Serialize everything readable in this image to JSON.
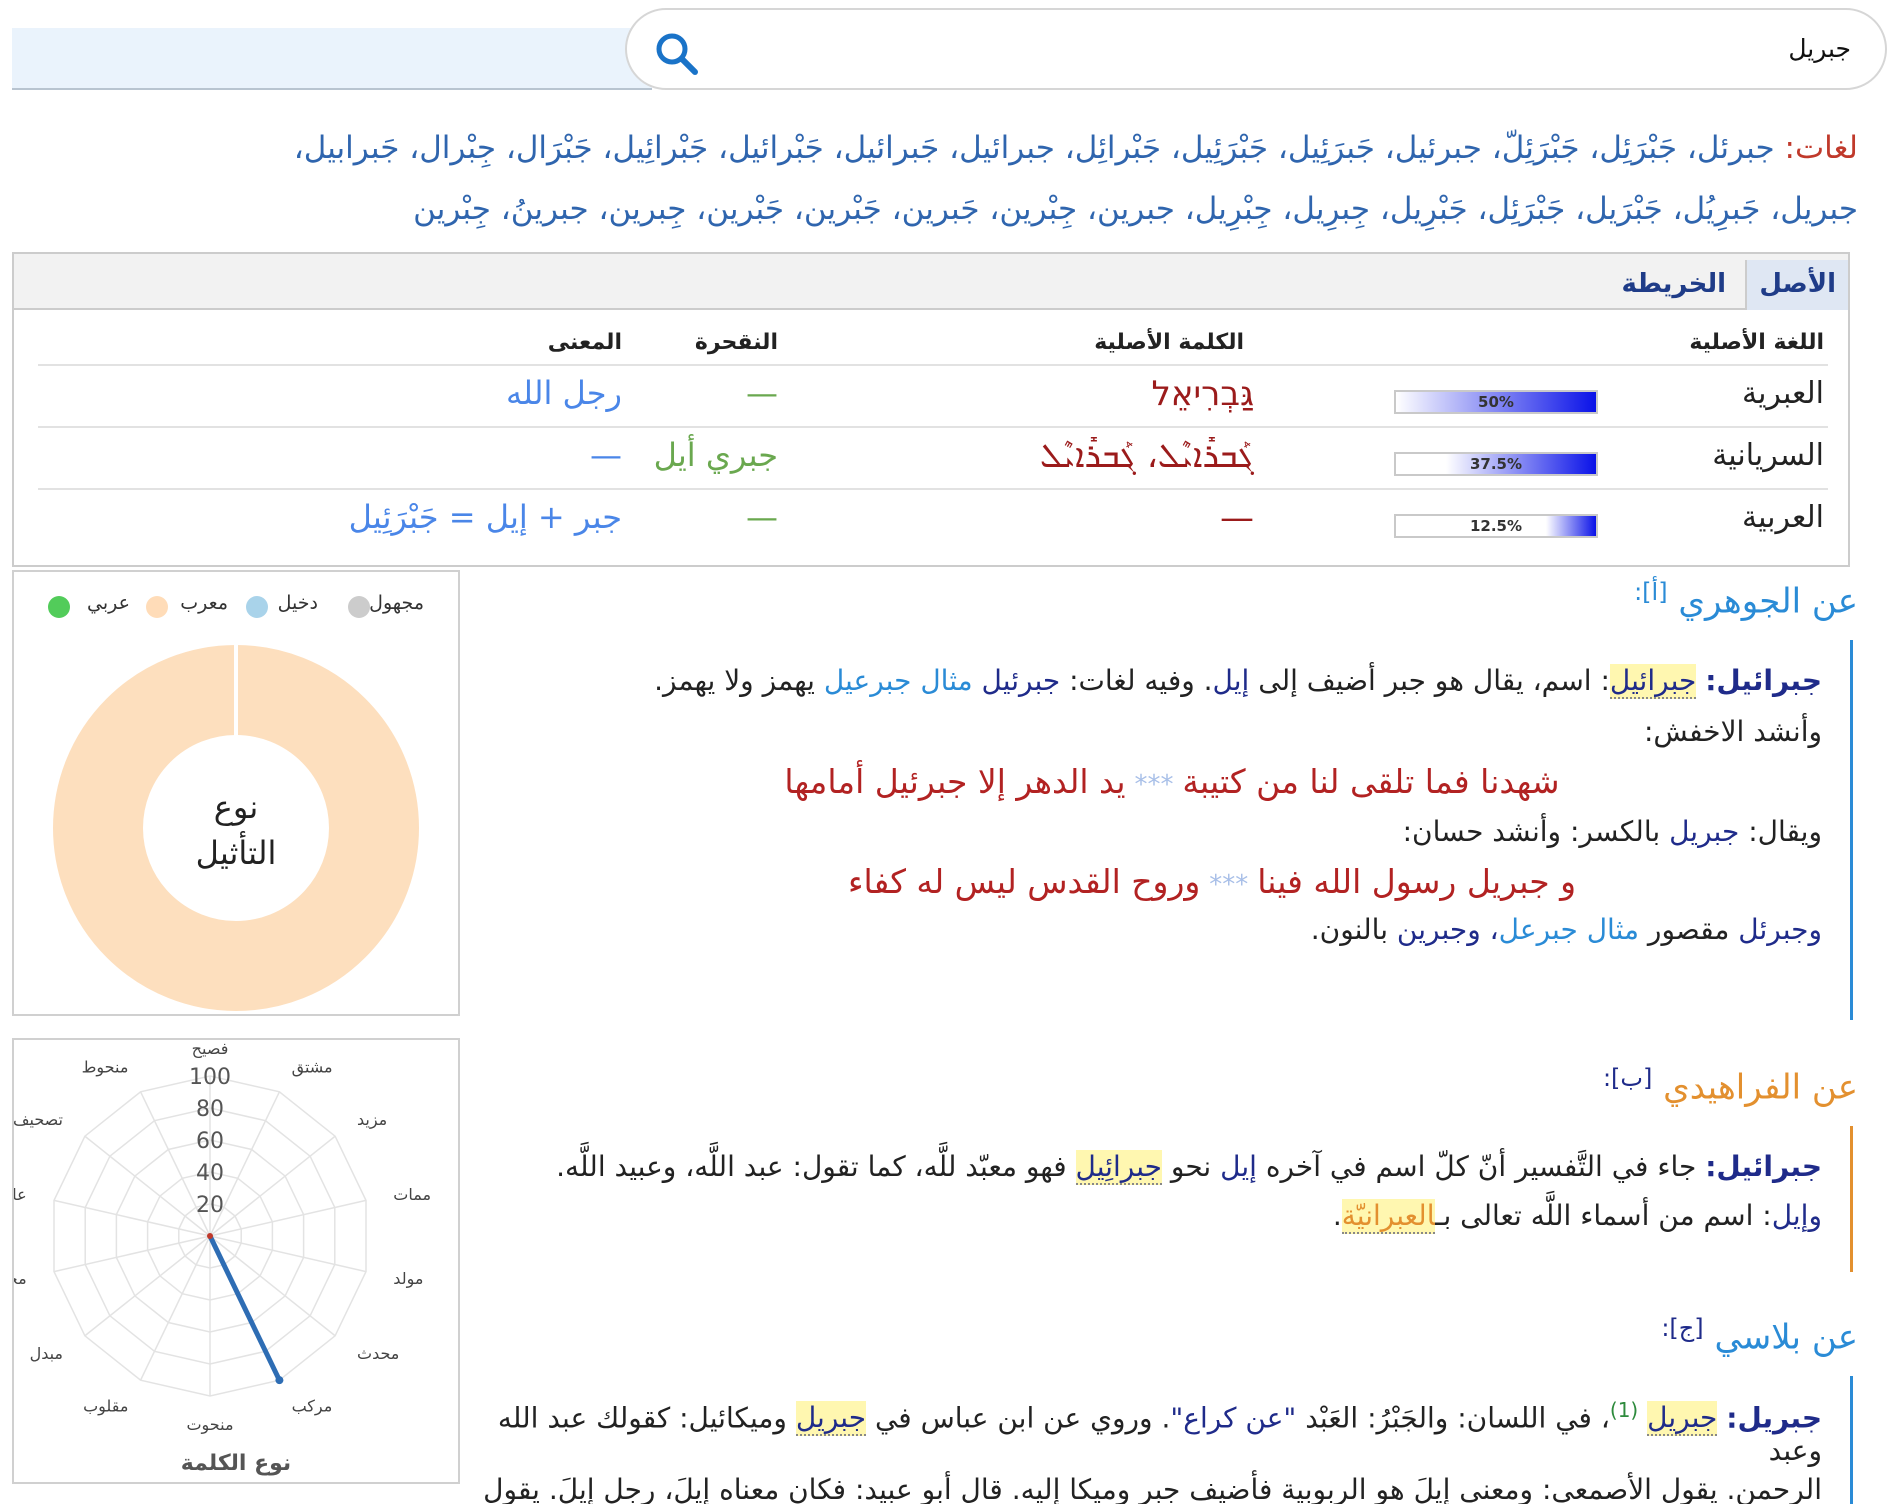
{
  "search": {
    "value": "جبريل"
  },
  "variants": {
    "label": "لغات:",
    "line1": "جبرئل، جَبْرَئِل، جَبْرَئِلّ، جبرئيل، جَبرَئِيل، جَبْرَئِيل، جَبْرائِل، جبرائيل، جَبرائيل، جَبْرائيل، جَبْرائِيل، جَبْرَال، جِبْرال، جَبرابيل،",
    "line2": "جبريل، جَبرِيُل، جَبْرَيل، جَبْرَئِل، جَبْرِيل، جِبرِيل، جِبْرِيل، جبرين، جِبْرين، جَبرين، جَبْرين، جَبْرين، جِبرين، جبرينُ، جِبْرين"
  },
  "origin": {
    "tabs": [
      "الأصل",
      "الخريطة"
    ],
    "headers": {
      "lang": "اللغة الأصلية",
      "word": "الكلمة الأصلية",
      "trans": "النقحرة",
      "meaning": "المعنى"
    },
    "rows": [
      {
        "lang": "العبرية",
        "percent": 50,
        "percent_label": "50%",
        "word": "גַּבְרִיאֵל",
        "trans": "—",
        "meaning": "رجل الله"
      },
      {
        "lang": "السريانية",
        "percent": 37.5,
        "percent_label": "37.5%",
        "word": "ܓܰܒܪܺܐܝܶܠ، ܓܰܒܪܺܐܝܶܠ",
        "trans": "جبري أيل",
        "meaning": "—"
      },
      {
        "lang": "العربية",
        "percent": 12.5,
        "percent_label": "12.5%",
        "word": "—",
        "trans": "—",
        "meaning": "جبر + إيل = جَبْرَئِيل"
      }
    ]
  },
  "donut": {
    "legend": [
      "مجهول",
      "دخيل",
      "معرب",
      "عربي"
    ],
    "legend_colors": [
      "#cccccc",
      "#a9d3ea",
      "#ffdcb8",
      "#52cc5a"
    ],
    "center_line1": "نوع",
    "center_line2": "التأثيل",
    "fill_color": "#fddfbe"
  },
  "radar": {
    "title": "نوع الكلمة",
    "axes": [
      "فصيح",
      "مشتق",
      "مزيد",
      "ممات",
      "مولد",
      "محدث",
      "مركب",
      "منحوت",
      "مقلوب",
      "مبدل",
      "مجمع",
      "عامي",
      "تصحيف",
      "منحوط"
    ],
    "ticks": [
      "20",
      "40",
      "60",
      "80",
      "100"
    ],
    "highlight_axis": "مركب",
    "highlight_value": 100
  },
  "sections": {
    "jawhari": {
      "title": "عن الجوهري",
      "ref": "[أ]:",
      "p1_head": "جبرائيل:",
      "p1_hl": "جبرائيل",
      "p1_a": ": اسم، يقال هو جبر أضيف إلى",
      "p1_il": "إيل",
      "p1_b": ". وفيه لغات:",
      "p1_jb": "جبرئيل",
      "p1_link": "مثال جبرعيل",
      "p1_c": "يهمز ولا يهمز.",
      "p2": "وأنشد الاخفش:",
      "verse1_a": "شهدنا فما تلقى لنا من كتيبة",
      "verse_sep": "***",
      "verse1_b": "يد الدهر إلا جبرئيل أمامها",
      "p3_a": "ويقال:",
      "p3_jb": "جبريل",
      "p3_b": "بالكسر: وأنشد حسان:",
      "verse2_a": "و جبريل رسول الله فينا",
      "verse2_b": "وروح القدس ليس له كفاء",
      "p4_jb": "وجبرئل",
      "p4_a": "مقصور",
      "p4_link": "مثال جبرعل",
      "p4_b": "، وجبرين",
      "p4_c": "بالنون."
    },
    "farahidi": {
      "title": "عن الفراهيدي",
      "ref": "[ب]:",
      "p1_head": "جبرائيل:",
      "p1_a": "جاء في التَّفسير أنّ كلّ اسم في آخره",
      "p1_il": "إيل",
      "p1_b": "نحو",
      "p1_hl": "جبرائِيل",
      "p1_c": "فهو معبّد للَّه، كما تقول: عبد اللَّه، وعبيد اللَّه.",
      "p2_il": "وإيل",
      "p2_a": ": اسم من أسماء اللَّه تعالى بـ",
      "p2_or": "العبرانيّة",
      "p2_b": "."
    },
    "balasi": {
      "title": "عن بلاسي",
      "ref": "[ج]:",
      "p1_head": "جبريل:",
      "p1_hl": "جبريل",
      "p1_num": "(1)",
      "p1_a": "، في اللسان: والجَبْرُ: العَبْد",
      "p1_q": "\"عن كراع\"",
      "p1_b": ". وروي عن ابن عباس في",
      "p1_hl2": "جبريل",
      "p1_c": "وميكائيل: كقولك عبد الله وعبد",
      "p2": "الرحمن. يقول الأصمعي: ومعنى إيلَ هو الربوبية فأضيف جبر وميكا إليه. قال أبو عبيد: فكان معناه إيلَ، رجل إيلَ. يقول"
    }
  }
}
